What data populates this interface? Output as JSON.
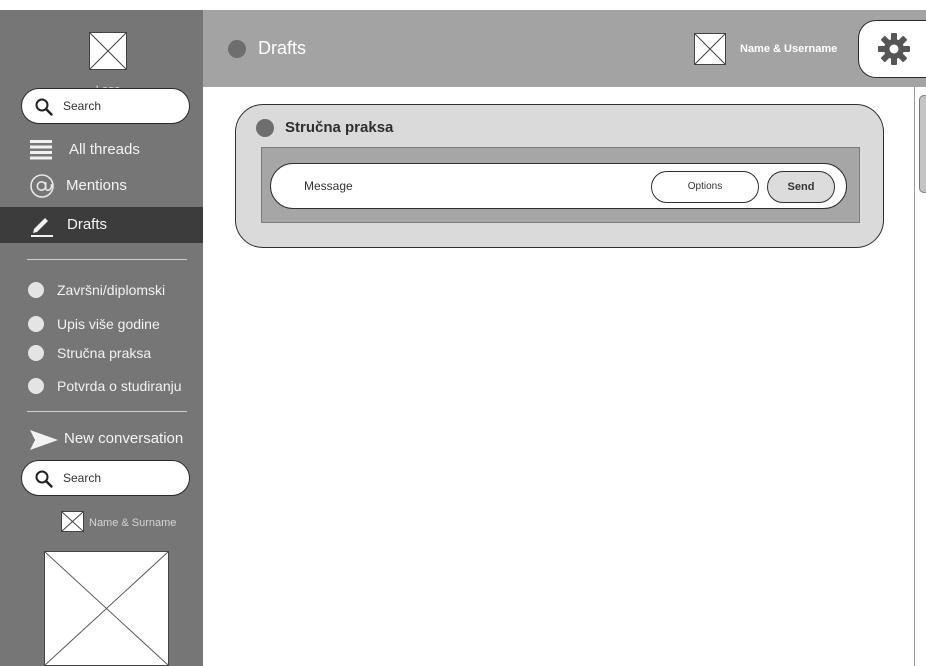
{
  "sidebar": {
    "logo_label": "Logo",
    "search_top": {
      "placeholder": "Search"
    },
    "nav": [
      {
        "label": "All threads",
        "icon": "list-icon"
      },
      {
        "label": "Mentions",
        "icon": "at-sign-icon"
      },
      {
        "label": "Drafts",
        "icon": "pencil-icon",
        "active": true
      }
    ],
    "threads": [
      {
        "label": "Završni/diplomski"
      },
      {
        "label": "Upis više godine"
      },
      {
        "label": "Stručna praksa"
      },
      {
        "label": "Potvrda o studiranju"
      }
    ],
    "new_conversation": {
      "label": "New conversation",
      "icon": "send-arrow-icon"
    },
    "search_bottom": {
      "placeholder": "Search"
    },
    "user": {
      "label": "Name & Surname"
    }
  },
  "header": {
    "title": "Drafts",
    "username": "Name & Username",
    "settings_icon": "gear-icon"
  },
  "conversation": {
    "name": "Stručna praksa",
    "message_placeholder": "Message",
    "options_label": "Options",
    "send_label": "Send"
  },
  "colors": {
    "sidebar_bg": "#767676",
    "sidebar_active": "#3c3c3c",
    "header_bg": "#a3a3a3",
    "card_bg": "#dadada",
    "compose_band": "#a6a6a6"
  }
}
